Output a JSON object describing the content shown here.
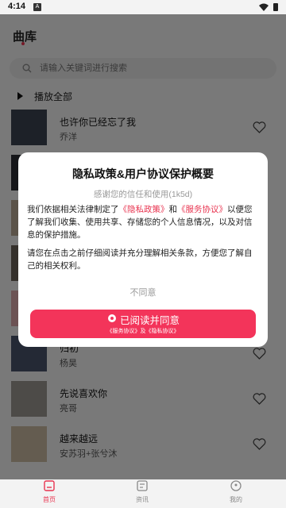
{
  "status_bar": {
    "time": "4:14",
    "notification_badge": "A"
  },
  "header": {
    "title": "曲库"
  },
  "search": {
    "placeholder": "请输入关键词进行搜索"
  },
  "play_all": {
    "label": "播放全部"
  },
  "songs": [
    {
      "name": "也许你已经忘了我",
      "artist": "乔洋",
      "cover_color": "#3a4250"
    },
    {
      "name": "",
      "artist": "",
      "cover_color": "#2a2d33"
    },
    {
      "name": "",
      "artist": "",
      "cover_color": "#b7a692"
    },
    {
      "name": "",
      "artist": "",
      "cover_color": "#6b6258"
    },
    {
      "name": "",
      "artist": "",
      "cover_color": "#d9a6a8"
    },
    {
      "name": "归初",
      "artist": "杨昊",
      "cover_color": "#48526a"
    },
    {
      "name": "先说喜欢你",
      "artist": "亮哥",
      "cover_color": "#9a9690"
    },
    {
      "name": "越来越远",
      "artist": "安苏羽+张兮沐",
      "cover_color": "#c9b8a0"
    }
  ],
  "dialog": {
    "title": "隐私政策&用户协议保护概要",
    "subtitle": "感谢您的信任和使用(1k5d)",
    "para1_pre": "我们依据相关法律制定了",
    "privacy_link": "《隐私政策》",
    "and": "和",
    "service_link": "《服务协议》",
    "para1_post": "以便您了解我们收集、使用共享、存储您的个人信息情况，以及对信息的保护措施。",
    "para2": "请您在点击之前仔细阅读并充分理解相关条款，方便您了解自己的相关权利。",
    "disagree_label": "不同意",
    "agree_label": "已阅读并同意",
    "agree_sub": "《服务协议》及《隐私协议》"
  },
  "tabs": [
    {
      "label": "首页",
      "icon": "home-icon"
    },
    {
      "label": "资讯",
      "icon": "news-icon"
    },
    {
      "label": "我的",
      "icon": "profile-icon"
    }
  ],
  "colors": {
    "accent": "#e8334f",
    "button": "#f3345a"
  }
}
